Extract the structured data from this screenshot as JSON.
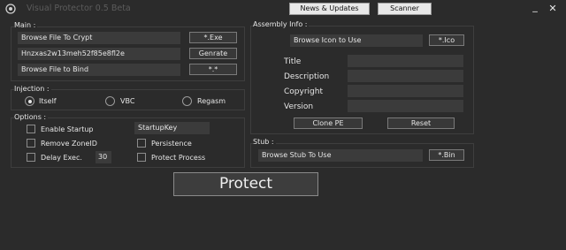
{
  "window": {
    "title": "Visual Protector 0.5 Beta",
    "news_button": "News & Updates",
    "scanner_button": "Scanner",
    "minimize": "_",
    "close": "✕"
  },
  "main": {
    "label": "Main :",
    "browse_crypt": "Browse File To Crypt",
    "exe_button": "*.Exe",
    "key_value": "Hnzxas2w13meh52f85e8fl2e",
    "generate_button": "Genrate",
    "browse_bind": "Browse File to Bind",
    "bind_button": "*.*"
  },
  "injection": {
    "label": "Injection :",
    "options": [
      "Itself",
      "VBC",
      "Regasm"
    ],
    "selected": "Itself"
  },
  "options": {
    "label": "Options :",
    "enable_startup": "Enable Startup",
    "startup_key": "StartupKey",
    "remove_zone_id": "Remove ZoneID",
    "persistence": "Persistence",
    "delay_exec": "Delay Exec.",
    "delay_value": "30",
    "protect_process": "Protect Process"
  },
  "assembly": {
    "label": "Assembly Info :",
    "browse_icon": "Browse Icon to Use",
    "ico_button": "*.Ico",
    "fields": [
      "Title",
      "Description",
      "Copyright",
      "Version"
    ],
    "clone_button": "Clone PE",
    "reset_button": "Reset"
  },
  "stub": {
    "label": "Stub :",
    "browse_stub": "Browse Stub To Use",
    "bin_button": "*.Bin"
  },
  "protect_button": "Protect"
}
